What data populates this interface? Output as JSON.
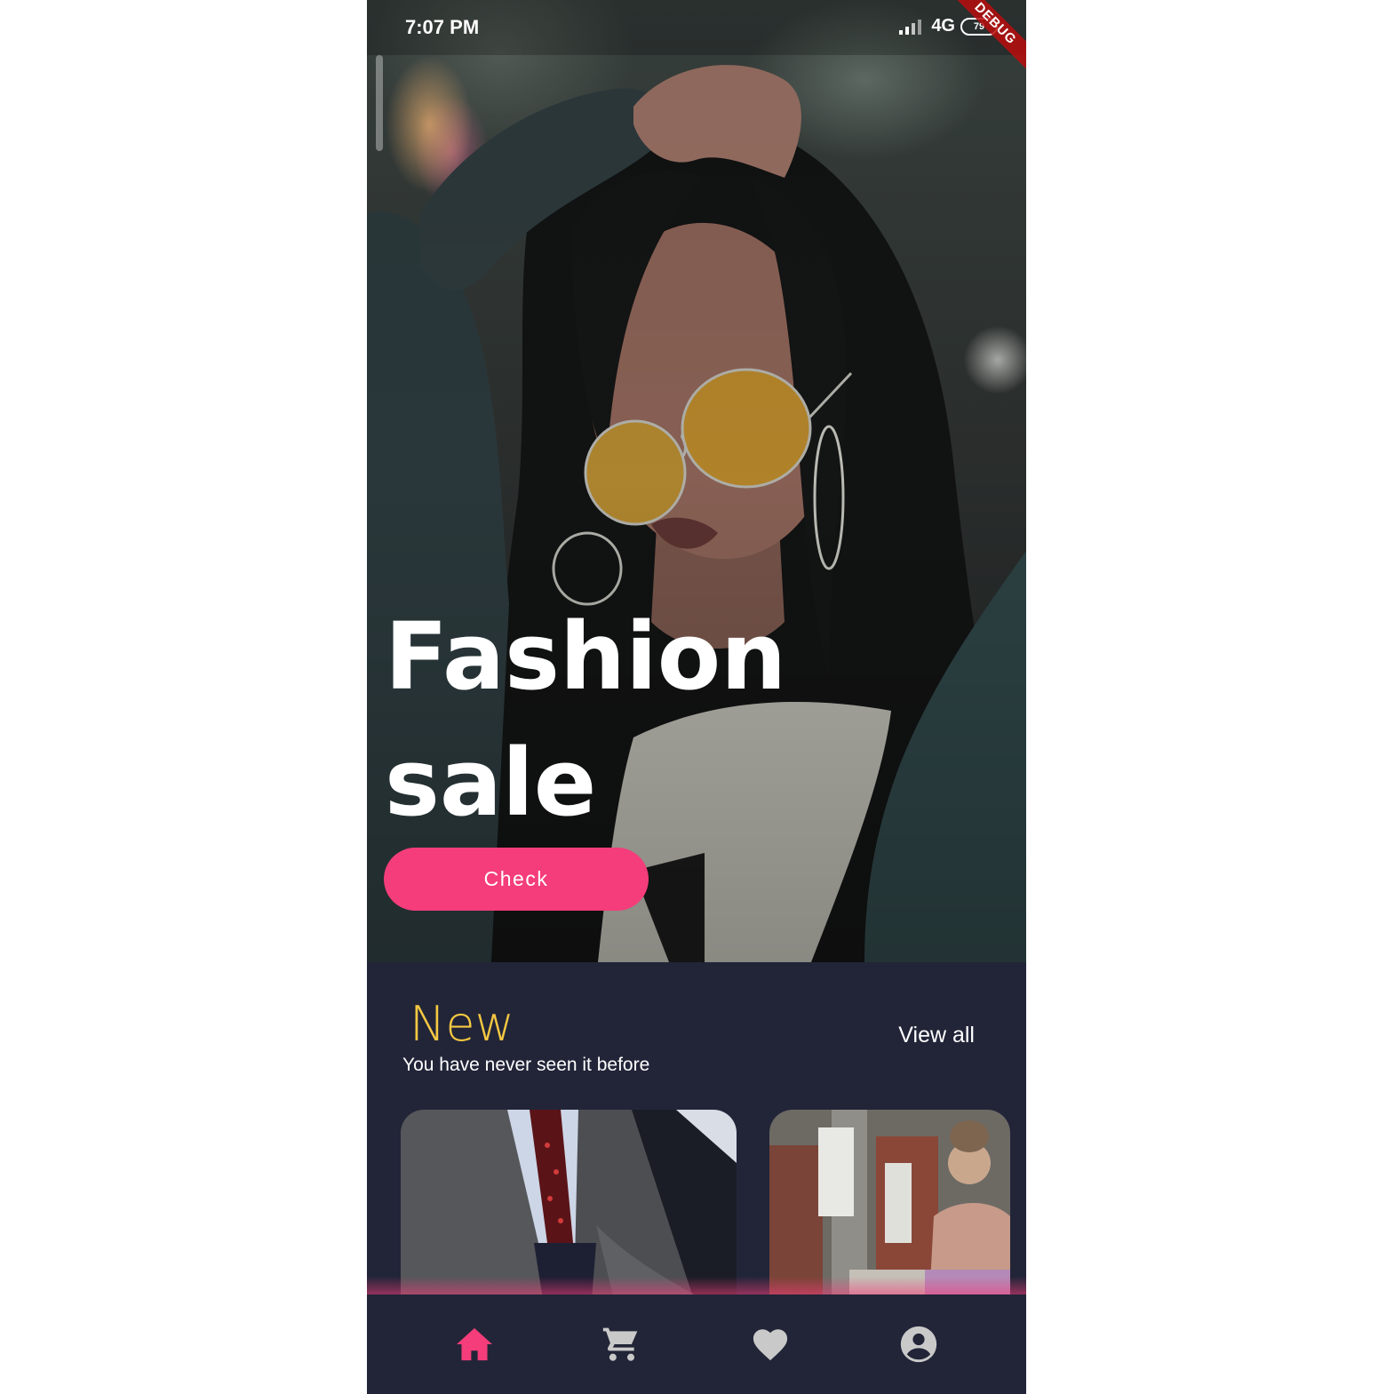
{
  "status_bar": {
    "time": "7:07 PM",
    "network": "4G",
    "battery": "79",
    "debug_banner": "DEBUG"
  },
  "hero": {
    "title_line1": "Fashion",
    "title_line2": "sale",
    "check_button": "Check"
  },
  "new_section": {
    "title": "New",
    "subtitle": "You have never seen it before",
    "view_all": "View all"
  },
  "bottom_nav": {
    "active": "home",
    "items": [
      {
        "icon": "home-icon"
      },
      {
        "icon": "cart-icon"
      },
      {
        "icon": "heart-icon"
      },
      {
        "icon": "account-icon"
      }
    ]
  },
  "colors": {
    "accent_pink": "#f43d7a",
    "title_yellow": "#f5c842",
    "background_navy": "#222538",
    "nav_inactive": "#c9c9c9"
  }
}
